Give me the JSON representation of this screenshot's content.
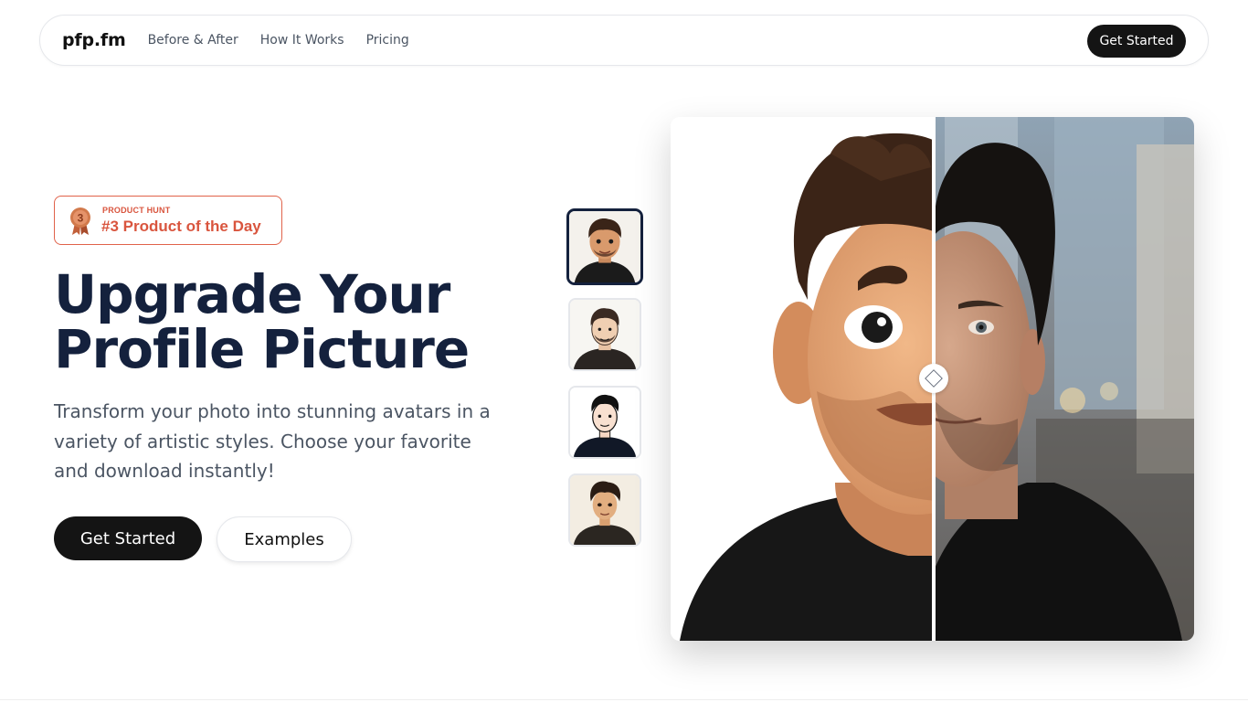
{
  "nav": {
    "logo": "pfp.fm",
    "links": [
      {
        "label": "Before & After"
      },
      {
        "label": "How It Works"
      },
      {
        "label": "Pricing"
      }
    ],
    "cta_label": "Get Started"
  },
  "badge": {
    "eyebrow": "PRODUCT HUNT",
    "title": "#3 Product of the Day",
    "medal_number": "3",
    "accent_color": "#d9553e"
  },
  "hero": {
    "headline_line1": "Upgrade Your",
    "headline_line2": "Profile Picture",
    "subtext": "Transform your photo into stunning avatars in a variety of artistic styles. Choose your favorite and download instantly!",
    "primary_label": "Get Started",
    "secondary_label": "Examples"
  },
  "styles": {
    "thumbnails": [
      {
        "name": "3d-cartoon-style",
        "selected": true
      },
      {
        "name": "sketch-style",
        "selected": false
      },
      {
        "name": "line-art-style",
        "selected": false
      },
      {
        "name": "anime-style",
        "selected": false
      }
    ]
  },
  "compare": {
    "handle_icon": "diamond-handle-icon",
    "split_position": 0.5
  },
  "colors": {
    "dark": "#141414",
    "heading": "#14213d",
    "body_text": "#4b5563"
  }
}
